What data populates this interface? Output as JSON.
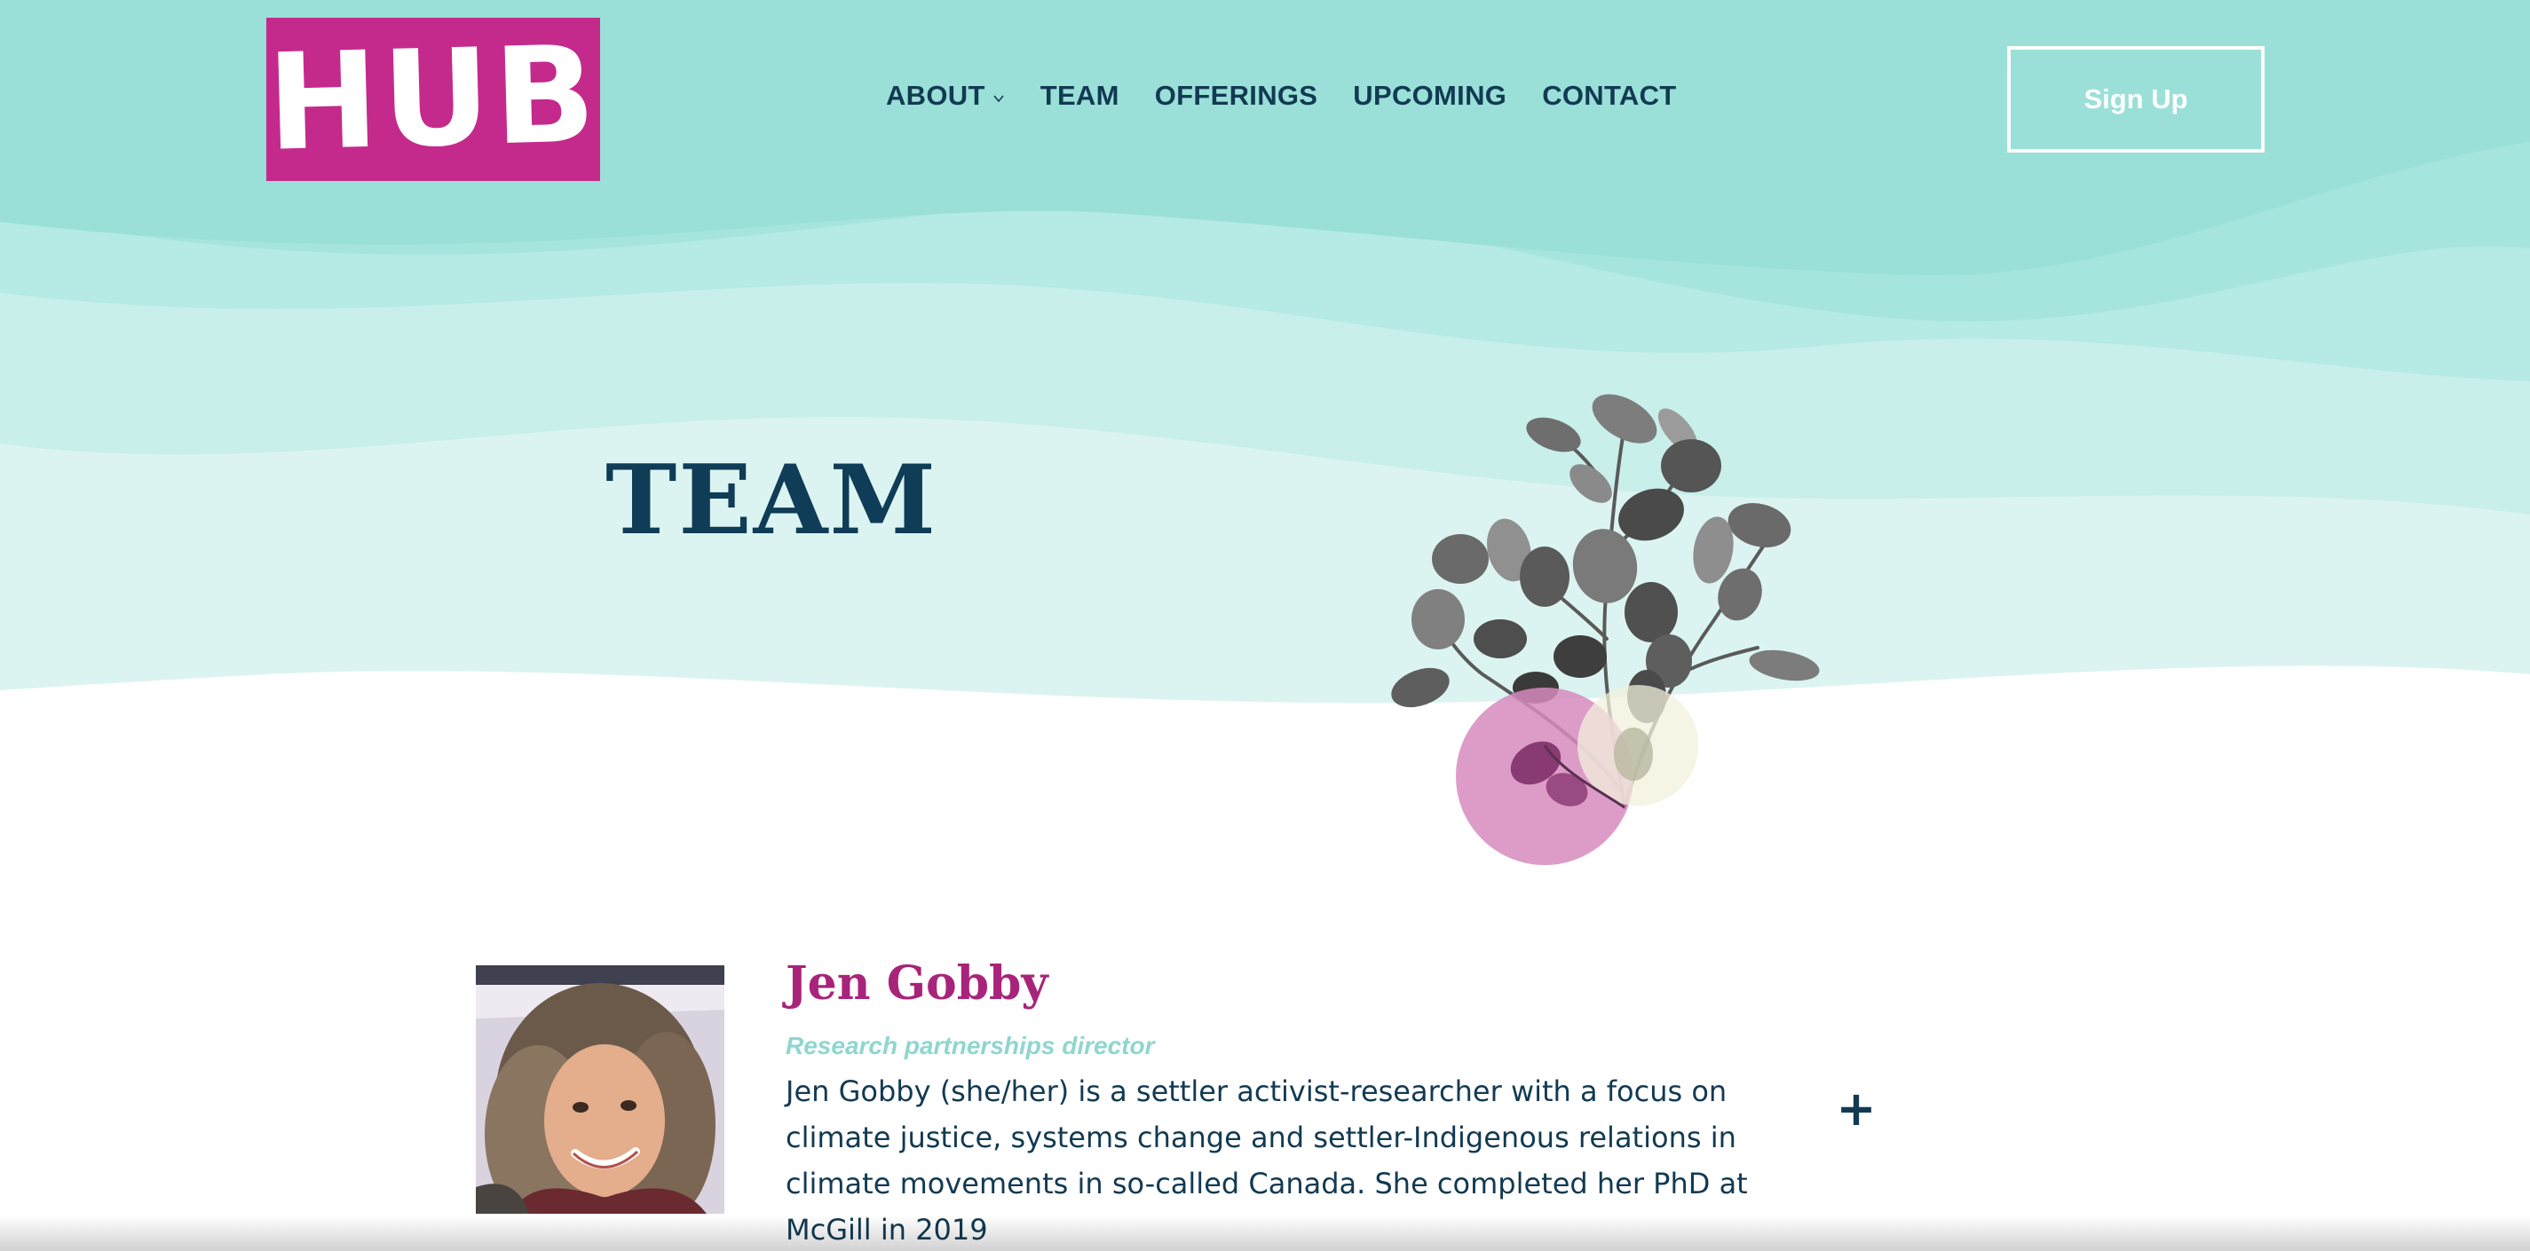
{
  "header": {
    "logo_text": "HUB",
    "nav": [
      {
        "label": "ABOUT",
        "has_dropdown": true
      },
      {
        "label": "TEAM",
        "has_dropdown": false
      },
      {
        "label": "OFFERINGS",
        "has_dropdown": false
      },
      {
        "label": "UPCOMING",
        "has_dropdown": false
      },
      {
        "label": "CONTACT",
        "has_dropdown": false
      }
    ],
    "signup_label": "Sign Up"
  },
  "page": {
    "title": "TEAM"
  },
  "team": [
    {
      "name": "Jen Gobby",
      "role": "Research partnerships director",
      "bio": "Jen Gobby (she/her) is a settler activist-researcher with a focus on climate justice, systems change and settler-Indigenous relations in climate movements in so-called Canada. She completed her PhD at McGill in 2019",
      "expand_icon": "plus-icon"
    }
  ],
  "colors": {
    "brand_magenta": "#c42a8c",
    "teal_light": "#9ae0d8",
    "navy": "#123a52",
    "name_magenta": "#a8247a",
    "role_teal": "#8fd6cf"
  }
}
